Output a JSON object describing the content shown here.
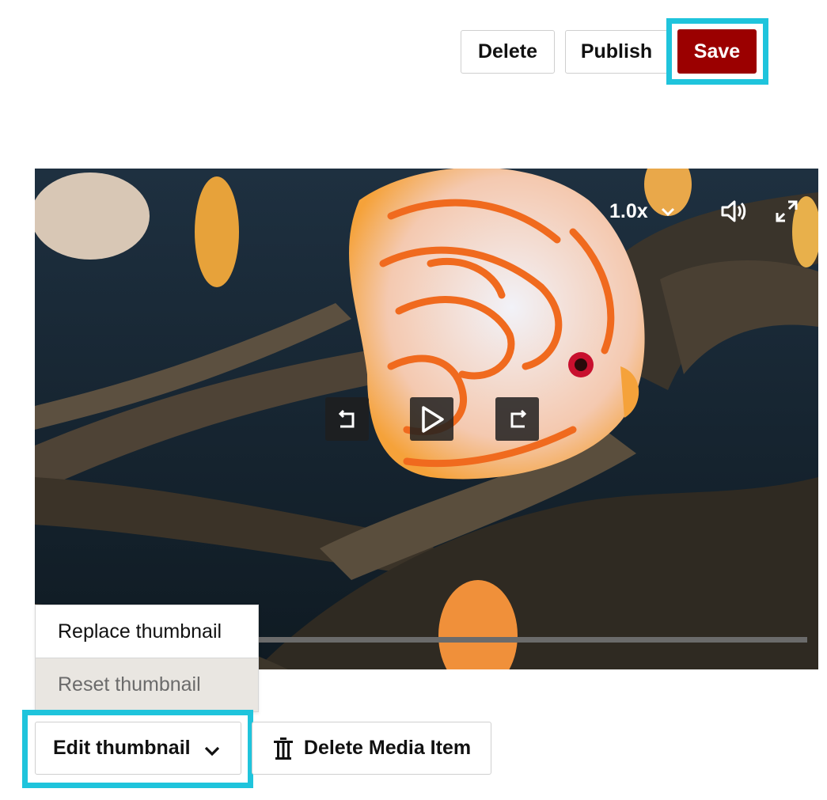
{
  "toolbar": {
    "delete_label": "Delete",
    "publish_label": "Publish",
    "save_label": "Save",
    "save_color": "#9b0000",
    "highlight_color": "#1fc4dc"
  },
  "video": {
    "speed_label": "1.0x",
    "icons": [
      "chevron-down-icon",
      "volume-icon",
      "fullscreen-icon",
      "rewind-icon",
      "play-icon",
      "forward-icon"
    ]
  },
  "thumbnail_menu": {
    "items": [
      {
        "label": "Replace thumbnail",
        "enabled": true
      },
      {
        "label": "Reset thumbnail",
        "enabled": false
      }
    ]
  },
  "actions": {
    "edit_thumbnail_label": "Edit thumbnail",
    "delete_media_label": "Delete Media Item"
  }
}
